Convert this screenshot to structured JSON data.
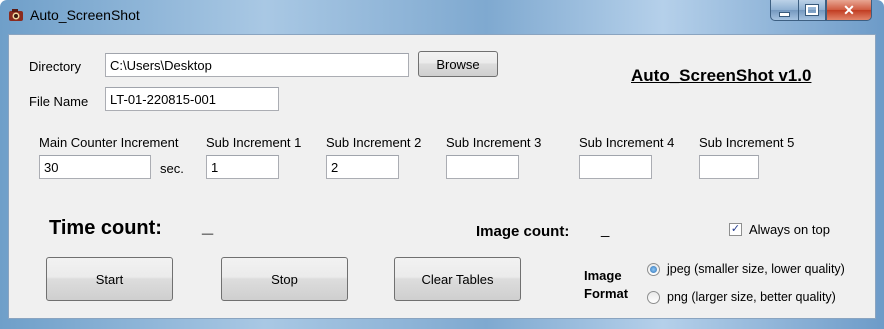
{
  "window": {
    "title": "Auto_ScreenShot",
    "close_glyph": "✕"
  },
  "app": {
    "heading": "Auto_ScreenShot v1.0"
  },
  "directory": {
    "label": "Directory",
    "value": "C:\\Users\\Desktop",
    "browse_label": "Browse"
  },
  "filename": {
    "label": "File Name",
    "value": "LT-01-220815-001"
  },
  "counters": {
    "main": {
      "label": "Main Counter Increment",
      "value": "30",
      "unit": "sec."
    },
    "subs": [
      {
        "label": "Sub Increment 1",
        "value": "1"
      },
      {
        "label": "Sub Increment 2",
        "value": "2"
      },
      {
        "label": "Sub Increment 3",
        "value": ""
      },
      {
        "label": "Sub Increment 4",
        "value": ""
      },
      {
        "label": "Sub Increment 5",
        "value": ""
      }
    ]
  },
  "status": {
    "time_label": "Time count:",
    "time_value": "_",
    "image_label": "Image count:",
    "image_value": "_"
  },
  "always_on_top": {
    "label": "Always on top",
    "checked": true,
    "check_glyph": "✓"
  },
  "buttons": {
    "start": "Start",
    "stop": "Stop",
    "clear": "Clear Tables"
  },
  "image_format": {
    "label_line1": "Image",
    "label_line2": "Format",
    "options": [
      {
        "label": "jpeg (smaller size, lower quality)",
        "selected": true
      },
      {
        "label": "png (larger size, better quality)",
        "selected": false
      }
    ]
  }
}
